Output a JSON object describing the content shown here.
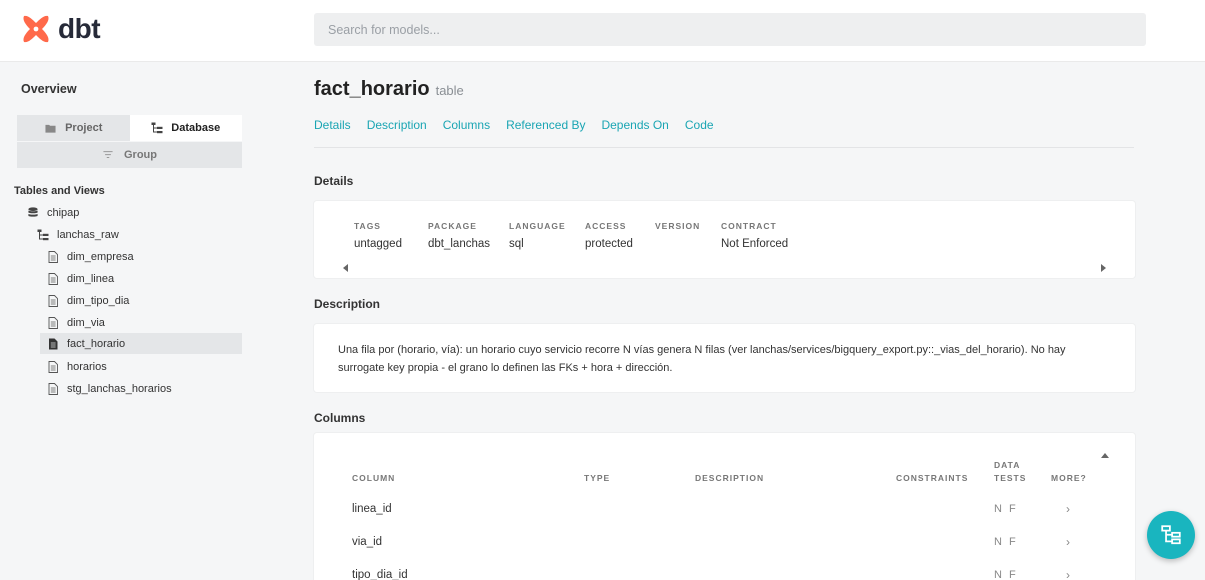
{
  "header": {
    "logo_text": "dbt",
    "search_placeholder": "Search for models..."
  },
  "sidebar": {
    "overview": "Overview",
    "tabs": {
      "project": "Project",
      "database": "Database",
      "group": "Group"
    },
    "section_title": "Tables and Views",
    "tree": [
      {
        "label": "chipap",
        "icon": "database-icon",
        "level": 0
      },
      {
        "label": "lanchas_raw",
        "icon": "schema-tree-icon",
        "level": 1
      },
      {
        "label": "dim_empresa",
        "icon": "file-icon",
        "level": 2
      },
      {
        "label": "dim_linea",
        "icon": "file-icon",
        "level": 2
      },
      {
        "label": "dim_tipo_dia",
        "icon": "file-icon",
        "level": 2
      },
      {
        "label": "dim_via",
        "icon": "file-icon",
        "level": 2
      },
      {
        "label": "fact_horario",
        "icon": "file-icon",
        "level": 2,
        "selected": true
      },
      {
        "label": "horarios",
        "icon": "file-icon",
        "level": 2
      },
      {
        "label": "stg_lanchas_horarios",
        "icon": "file-icon",
        "level": 2
      }
    ]
  },
  "model": {
    "name": "fact_horario",
    "type": "table",
    "nav": [
      "Details",
      "Description",
      "Columns",
      "Referenced By",
      "Depends On",
      "Code"
    ]
  },
  "details": {
    "heading": "Details",
    "fields": [
      {
        "label": "TAGS",
        "value": "untagged"
      },
      {
        "label": "PACKAGE",
        "value": "dbt_lanchas"
      },
      {
        "label": "LANGUAGE",
        "value": "sql"
      },
      {
        "label": "ACCESS",
        "value": "protected"
      },
      {
        "label": "VERSION",
        "value": ""
      },
      {
        "label": "CONTRACT",
        "value": "Not Enforced"
      }
    ]
  },
  "description": {
    "heading": "Description",
    "text": "Una fila por (horario, vía): un horario cuyo servicio recorre N vías genera N filas (ver lanchas/services/bigquery_export.py::_vias_del_horario). No hay surrogate key propia - el grano lo definen las FKs + hora + dirección."
  },
  "columns": {
    "heading": "Columns",
    "headers": {
      "column": "COLUMN",
      "type": "TYPE",
      "description": "DESCRIPTION",
      "constraints": "CONSTRAINTS",
      "data_tests": "DATA TESTS",
      "more": "MORE?"
    },
    "rows": [
      {
        "name": "linea_id",
        "tests": "N F",
        "more": "›"
      },
      {
        "name": "via_id",
        "tests": "N F",
        "more": "›"
      },
      {
        "name": "tipo_dia_id",
        "tests": "N F",
        "more": "›"
      }
    ]
  },
  "colors": {
    "accent": "#1aa5b3",
    "fab": "#19b5bf",
    "logo": "#ff694a"
  }
}
